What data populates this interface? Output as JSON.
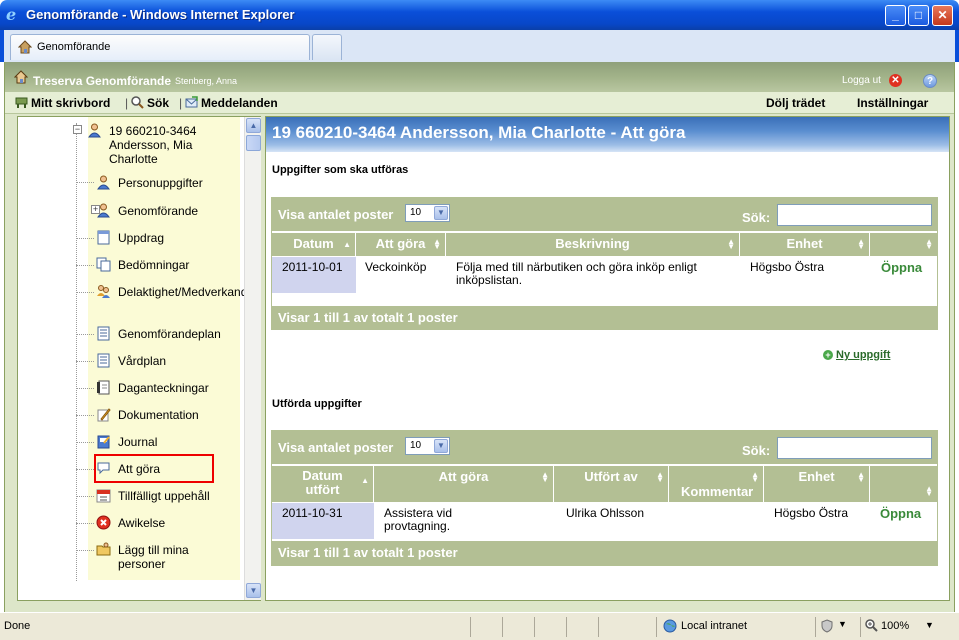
{
  "window": {
    "title": "Genomförande - Windows Internet Explorer"
  },
  "browser_tab": {
    "label": "Genomförande"
  },
  "app": {
    "name": "Treserva Genomförande",
    "user": "Stenberg, Anna",
    "logout_label": "Logga ut"
  },
  "toolbar": {
    "desktop": "Mitt skrivbord",
    "search": "Sök",
    "messages": "Meddelanden",
    "hide_tree": "Dölj trädet",
    "settings": "Inställningar"
  },
  "tree": {
    "root_label": "19 660210-3464 Andersson, Mia Charlotte",
    "items": [
      {
        "label": "Personuppgifter",
        "icon": "person-icon"
      },
      {
        "label": "Genomförande",
        "icon": "person-icon"
      },
      {
        "label": "Uppdrag",
        "icon": "document-icon"
      },
      {
        "label": "Bedömningar",
        "icon": "documents-icon"
      },
      {
        "label": "Delaktighet/Medverkande",
        "icon": "people-icon"
      },
      {
        "label": "Genomförandeplan",
        "icon": "list-icon"
      },
      {
        "label": "Vårdplan",
        "icon": "list-icon"
      },
      {
        "label": "Daganteckningar",
        "icon": "notes-icon"
      },
      {
        "label": "Dokumentation",
        "icon": "pencil-icon"
      },
      {
        "label": "Journal",
        "icon": "journal-icon"
      },
      {
        "label": "Att göra",
        "icon": "speech-icon"
      },
      {
        "label": "Tillfälligt uppehåll",
        "icon": "calendar-icon"
      },
      {
        "label": "Awikelse",
        "icon": "error-icon"
      },
      {
        "label": "Lägg till mina personer",
        "icon": "folder-icon"
      }
    ]
  },
  "page_title": "19 660210-3464 Andersson, Mia Charlotte - Att göra",
  "pending": {
    "title": "Uppgifter som ska utföras",
    "show_label": "Visa antalet poster",
    "page_size": "10",
    "search_label": "Sök:",
    "columns": [
      "Datum",
      "Att göra",
      "Beskrivning",
      "Enhet",
      ""
    ],
    "rows": [
      {
        "date": "2011-10-01",
        "task": "Veckoinköp",
        "description": "Följa med till närbutiken och göra inköp enligt inköpslistan.",
        "unit": "Högsbo Östra",
        "action": "Öppna"
      }
    ],
    "footer": "Visar 1 till 1 av totalt 1 poster",
    "new_task": "Ny uppgift"
  },
  "done": {
    "title": "Utförda uppgifter",
    "show_label": "Visa antalet poster",
    "page_size": "10",
    "search_label": "Sök:",
    "columns": [
      "Datum utfört",
      "Att göra",
      "Utfört av",
      "Kommentar",
      "Enhet",
      ""
    ],
    "rows": [
      {
        "date": "2011-10-31",
        "task": "Assistera vid provtagning.",
        "by": "Ulrika Ohlsson",
        "comment": "",
        "unit": "Högsbo Östra",
        "action": "Öppna"
      }
    ],
    "footer": "Visar 1 till 1 av totalt 1 poster"
  },
  "status": {
    "left": "Done",
    "zone": "Local intranet",
    "zoom": "100%"
  }
}
